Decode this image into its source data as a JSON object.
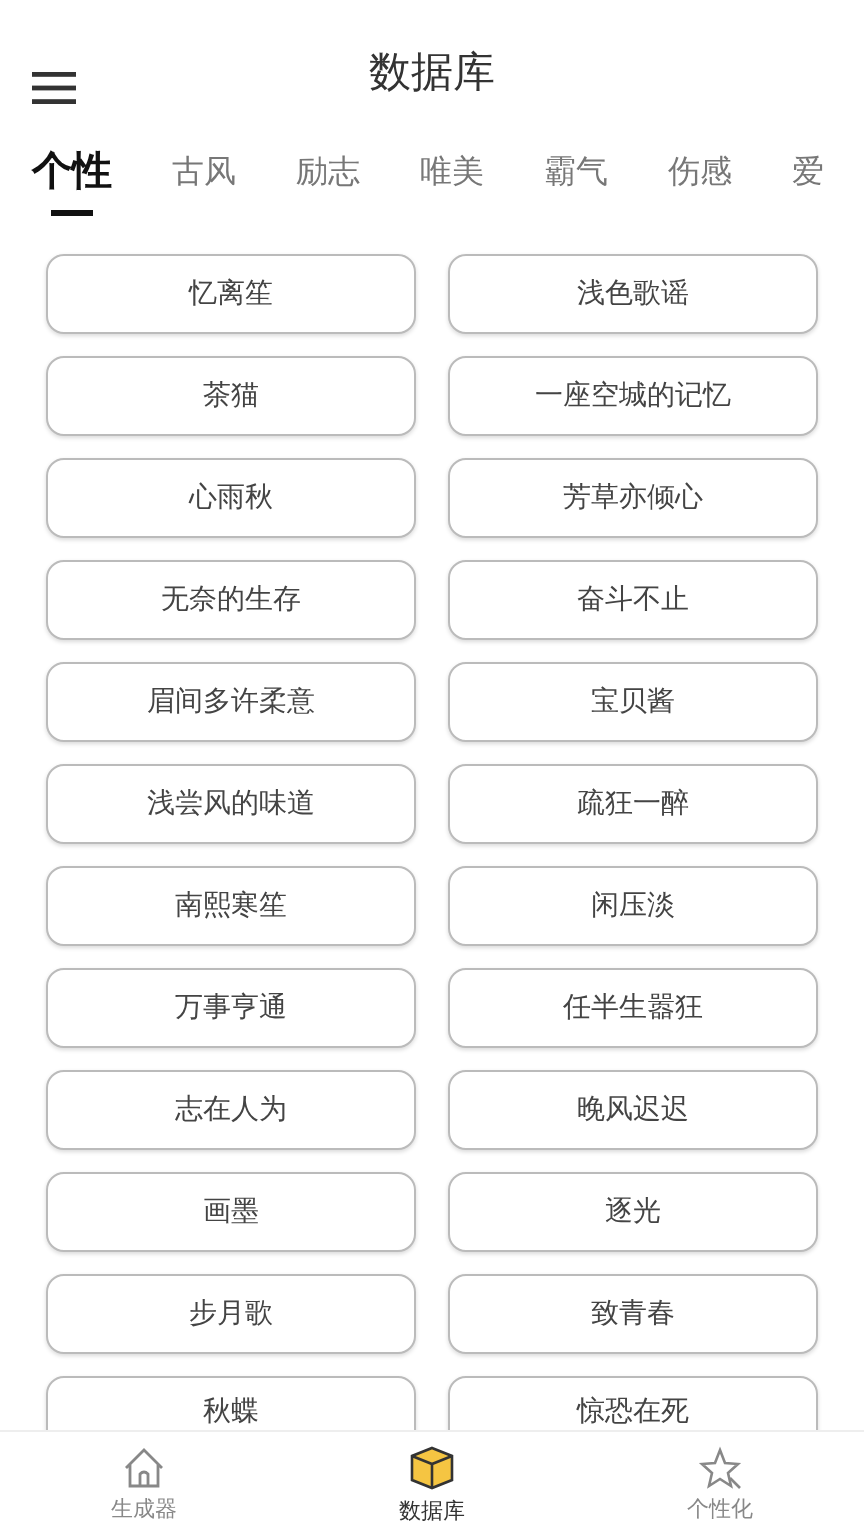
{
  "header": {
    "title": "数据库"
  },
  "tabs": [
    {
      "label": "个性",
      "selected": true
    },
    {
      "label": "古风",
      "selected": false
    },
    {
      "label": "励志",
      "selected": false
    },
    {
      "label": "唯美",
      "selected": false
    },
    {
      "label": "霸气",
      "selected": false
    },
    {
      "label": "伤感",
      "selected": false
    },
    {
      "label": "爱",
      "selected": false
    }
  ],
  "names": [
    "忆离笙",
    "浅色歌谣",
    "茶猫",
    "一座空城的记忆",
    "心雨秋",
    "芳草亦倾心",
    "无奈的生存",
    "奋斗不止",
    "眉间多许柔意",
    "宝贝酱",
    "浅尝风的味道",
    "疏狂一醉",
    "南熙寒笙",
    "闲压淡",
    "万事亨通",
    "任半生嚣狂",
    "志在人为",
    "晚风迟迟",
    "画墨",
    "逐光",
    "步月歌",
    "致青春",
    "秋蝶",
    "惊恐在死"
  ],
  "bottom_nav": [
    {
      "label": "生成器",
      "selected": false
    },
    {
      "label": "数据库",
      "selected": true
    },
    {
      "label": "个性化",
      "selected": false
    }
  ]
}
